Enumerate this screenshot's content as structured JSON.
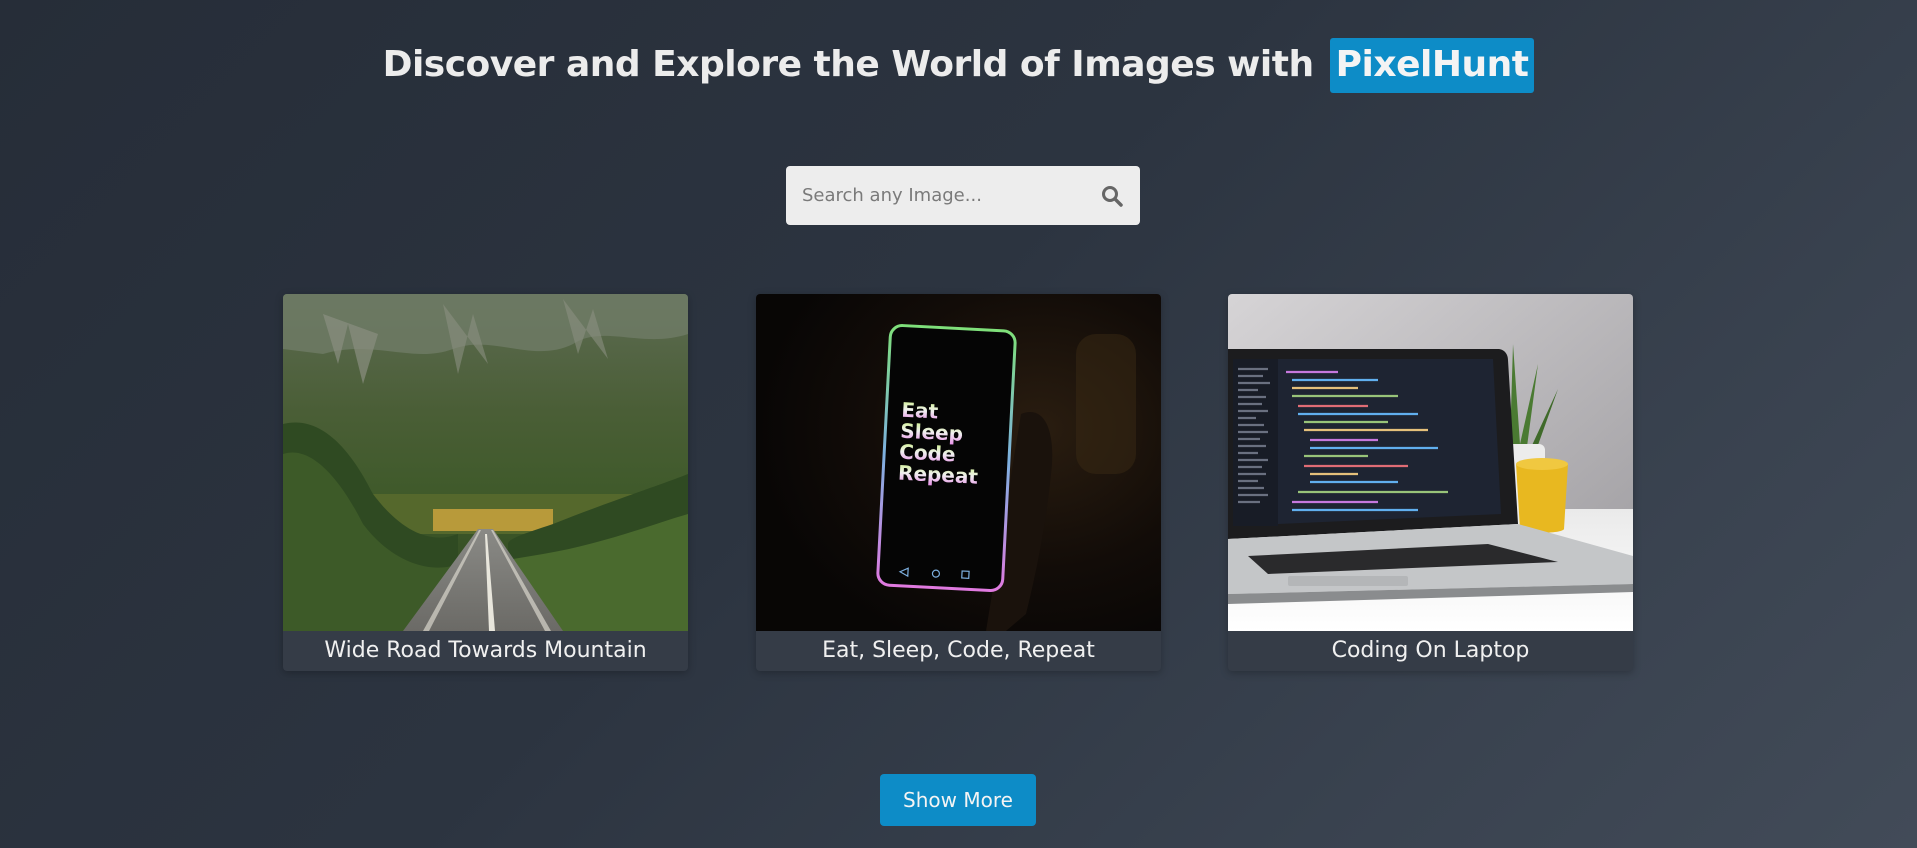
{
  "header": {
    "title_prefix": "Discover and Explore the World of Images with",
    "brand": "PixelHunt"
  },
  "search": {
    "placeholder": "Search any Image...",
    "value": "",
    "icon": "search-icon"
  },
  "gallery": [
    {
      "caption": "Wide Road Towards Mountain",
      "image": "mountain-road-photo"
    },
    {
      "caption": "Eat, Sleep, Code, Repeat",
      "image": "phone-photo",
      "phone_text": [
        "Eat",
        "Sleep",
        "Code",
        "Repeat"
      ]
    },
    {
      "caption": "Coding On Laptop",
      "image": "laptop-photo"
    }
  ],
  "actions": {
    "show_more_label": "Show More"
  },
  "colors": {
    "accent": "#0d8cc7",
    "background": "#2c3440",
    "card": "#353c47"
  }
}
